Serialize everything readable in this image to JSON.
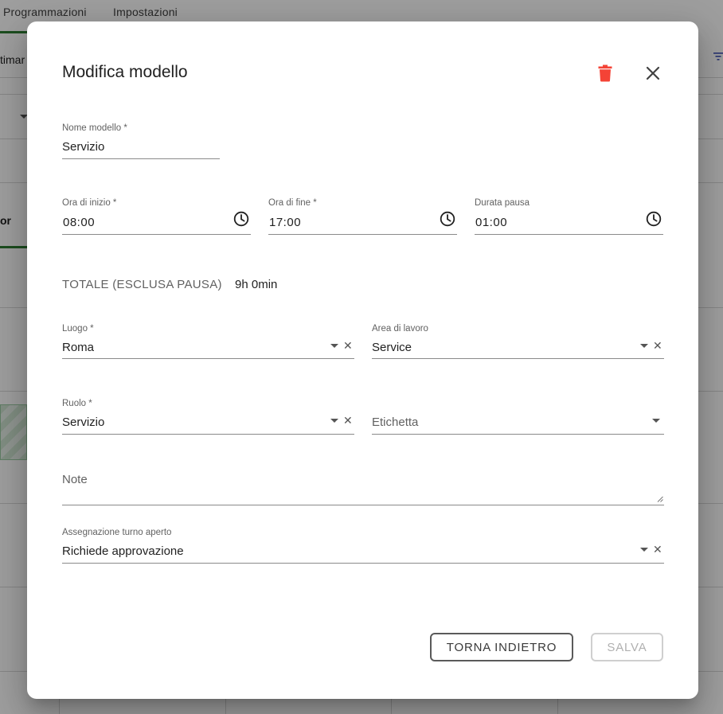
{
  "background": {
    "tabs": [
      "Programmazioni",
      "Impostazioni"
    ],
    "fragments": [
      "timar",
      "or"
    ]
  },
  "dialog": {
    "title": "Modifica modello",
    "fields": {
      "nome": {
        "label": "Nome modello *",
        "value": "Servizio"
      },
      "inizio": {
        "label": "Ora di inizio *",
        "value": "08:00"
      },
      "fine": {
        "label": "Ora di fine *",
        "value": "17:00"
      },
      "pausa": {
        "label": "Durata pausa",
        "value": "01:00"
      },
      "luogo": {
        "label": "Luogo *",
        "value": "Roma"
      },
      "area": {
        "label": "Area di lavoro",
        "value": "Service"
      },
      "ruolo": {
        "label": "Ruolo *",
        "value": "Servizio"
      },
      "etichetta": {
        "placeholder": "Etichetta"
      },
      "note": {
        "placeholder": "Note"
      },
      "assegnazione": {
        "label": "Assegnazione turno aperto",
        "value": "Richiede approvazione"
      }
    },
    "total": {
      "label": "TOTALE (ESCLUSA PAUSA)",
      "value": "9h 0min"
    },
    "buttons": {
      "back": "TORNA INDIETRO",
      "save": "SALVA"
    }
  },
  "icons": {
    "delete": "trash-icon",
    "close": "close-icon",
    "time": "clock-icon",
    "dropdown": "caret-down-icon",
    "clear": "clear-icon"
  },
  "colors": {
    "delete": "#f44336",
    "accent": "#2e7d32"
  }
}
